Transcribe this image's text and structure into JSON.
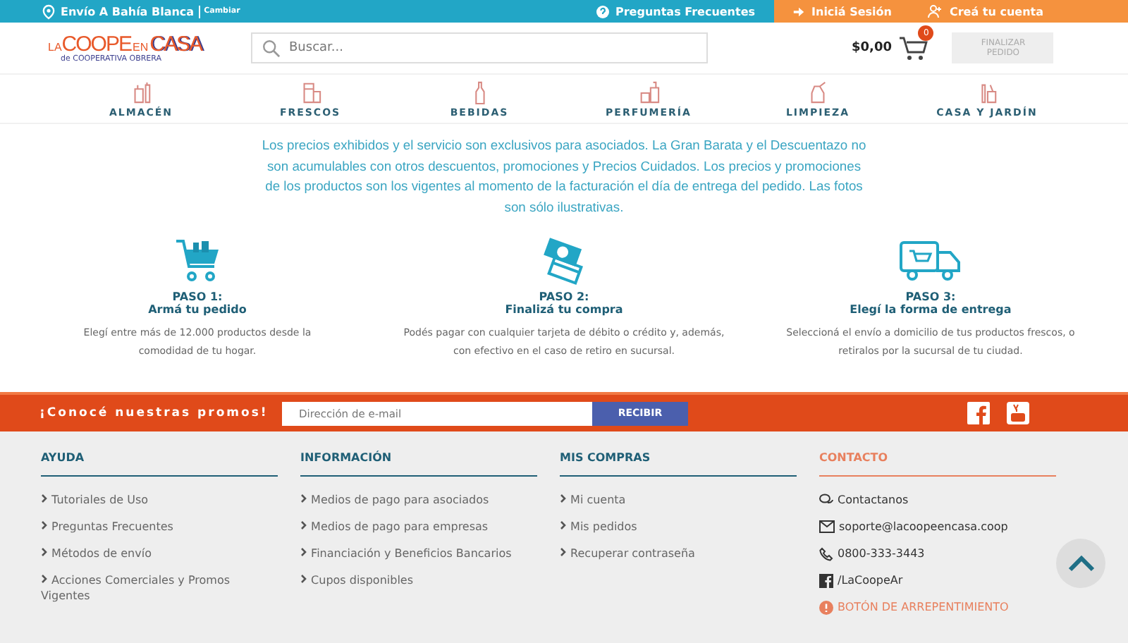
{
  "top_bar": {
    "delivery": {
      "label": "Envío A Bahía Blanca",
      "action": "Cambiar"
    },
    "links": [
      {
        "label": "Preguntas Frecuentes",
        "highlighted": false,
        "kind": "help"
      },
      {
        "label": "Iniciá Sesión",
        "highlighted": true,
        "kind": "login"
      },
      {
        "label": "Creá tu cuenta",
        "highlighted": true,
        "kind": "user"
      }
    ]
  },
  "header": {
    "logo": {
      "parts": [
        "LA",
        "COOPE",
        "EN",
        "CASA"
      ],
      "subtitle": "de COOPERATIVA OBRERA"
    },
    "search": {
      "placeholder": "Buscar..."
    },
    "total": "$0,00",
    "cart_count": "0",
    "checkout": {
      "label": "FINALIZAR PEDIDO",
      "disabled": true
    }
  },
  "categories": [
    {
      "label": "ALMACÉN"
    },
    {
      "label": "FRESCOS"
    },
    {
      "label": "BEBIDAS"
    },
    {
      "label": "PERFUMERÍA"
    },
    {
      "label": "LIMPIEZA"
    },
    {
      "label": "CASA Y JARDÍN"
    }
  ],
  "notice": "Los precios exhibidos y el servicio son exclusivos para asociados. La Gran Barata y el Descuentazo no son acumulables con otros descuentos, promociones y Precios Cuidados. Los precios y promociones de los productos son los vigentes al momento de la facturación el día de entrega del pedido. Las fotos son sólo ilustrativas.",
  "steps": [
    {
      "step": "PASO 1:",
      "title": "Armá tu pedido",
      "text": "Elegí entre más de 12.000 productos desde la comodidad de tu hogar."
    },
    {
      "step": "PASO 2:",
      "title": "Finalizá tu compra",
      "text": "Podés pagar con cualquier tarjeta de débito o crédito y, además, con efectivo en el caso de retiro en sucursal."
    },
    {
      "step": "PASO 3:",
      "title": "Elegí la forma de entrega",
      "text": "Seleccioná el envío a domicilio de tus productos frescos, o retiralos por la sucursal de tu ciudad."
    }
  ],
  "newsletter": {
    "title": "¡Conocé nuestras promos!",
    "placeholder": "Dirección de e-mail",
    "button": "RECIBIR"
  },
  "footer": [
    {
      "title": "AYUDA",
      "kind": "links",
      "items": [
        {
          "label": "Tutoriales de Uso"
        },
        {
          "label": "Preguntas Frecuentes"
        },
        {
          "label": "Métodos de envío"
        },
        {
          "label": "Acciones Comerciales y Promos Vigentes"
        }
      ]
    },
    {
      "title": "INFORMACIÓN",
      "kind": "links",
      "items": [
        {
          "label": "Medios de pago para asociados"
        },
        {
          "label": "Medios de pago para empresas"
        },
        {
          "label": "Financiación y Beneficios Bancarios"
        },
        {
          "label": "Cupos disponibles"
        }
      ]
    },
    {
      "title": "MIS COMPRAS",
      "kind": "links",
      "items": [
        {
          "label": "Mi cuenta"
        },
        {
          "label": "Mis pedidos"
        },
        {
          "label": "Recuperar contraseña"
        }
      ]
    },
    {
      "title": "CONTACTO",
      "kind": "contact",
      "items": [
        {
          "label": "Contactanos",
          "kind": "chat"
        },
        {
          "label": "soporte@lacoopeencasa.coop",
          "kind": "mail"
        },
        {
          "label": "0800-333-3443",
          "kind": "phone"
        },
        {
          "label": "/LaCoopeAr",
          "kind": "facebook"
        },
        {
          "label": "BOTÓN DE ARREPENTIMIENTO",
          "kind": "alert"
        }
      ]
    }
  ]
}
